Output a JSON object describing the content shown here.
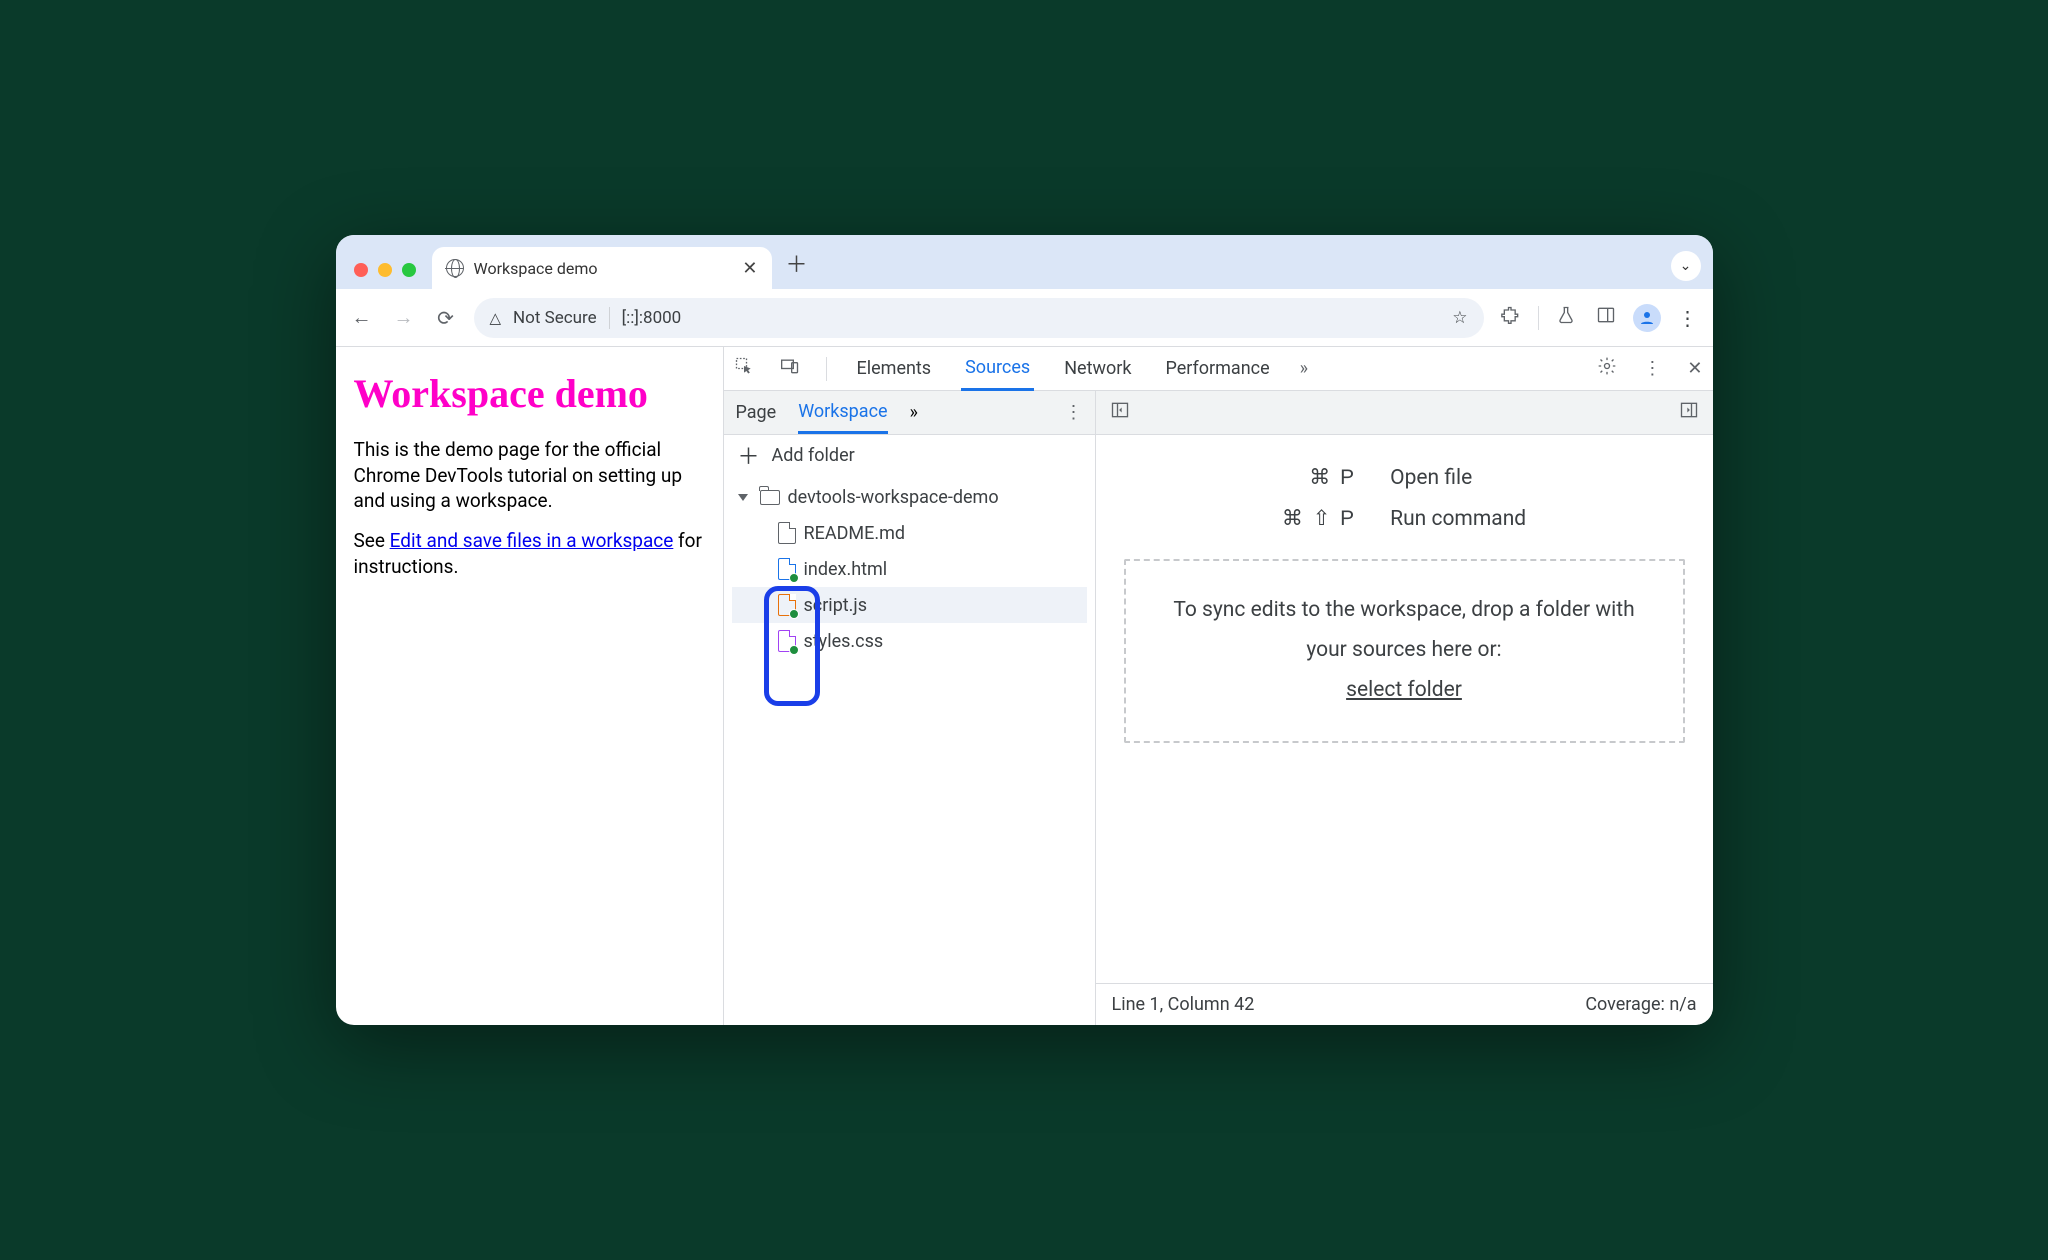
{
  "browser": {
    "tab_title": "Workspace demo",
    "security_label": "Not Secure",
    "url_display": "[::]:8000"
  },
  "page": {
    "heading": "Workspace demo",
    "paragraph": "This is the demo page for the official Chrome DevTools tutorial on setting up and using a workspace.",
    "see_prefix": "See ",
    "link_text": "Edit and save files in a workspace",
    "see_suffix": " for instructions."
  },
  "devtools": {
    "tabs": {
      "elements": "Elements",
      "sources": "Sources",
      "network": "Network",
      "performance": "Performance"
    },
    "navigator": {
      "page_tab": "Page",
      "workspace_tab": "Workspace",
      "add_folder": "Add folder",
      "root": "devtools-workspace-demo",
      "files": {
        "readme": "README.md",
        "index": "index.html",
        "script": "script.js",
        "styles": "styles.css"
      }
    },
    "editor": {
      "open_file_keys": "⌘ P",
      "open_file_label": "Open file",
      "run_cmd_keys": "⌘ ⇧ P",
      "run_cmd_label": "Run command",
      "drop_text": "To sync edits to the workspace, drop a folder with your sources here or:",
      "select_folder": "select folder",
      "status_pos": "Line 1, Column 42",
      "status_cov": "Coverage: n/a"
    }
  }
}
